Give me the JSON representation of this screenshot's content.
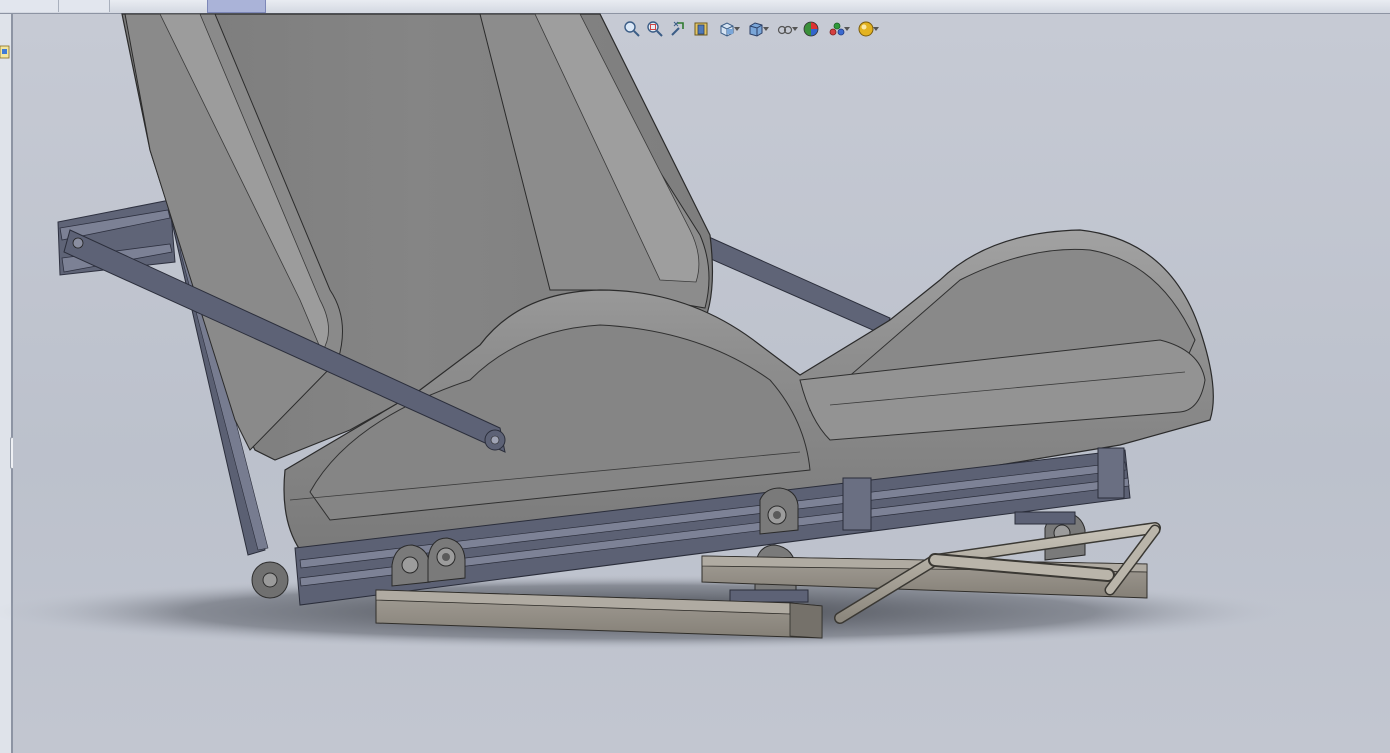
{
  "window": {
    "tabs": [
      {
        "id": "tab-1"
      },
      {
        "id": "tab-2"
      },
      {
        "id": "tab-3",
        "active": true
      }
    ]
  },
  "heads_up_toolbar": {
    "buttons": [
      {
        "name": "zoom-to-fit",
        "icon": "zoom-fit-icon"
      },
      {
        "name": "zoom-to-area",
        "icon": "zoom-area-icon"
      },
      {
        "name": "previous-view",
        "icon": "previous-view-icon"
      },
      {
        "name": "section-view",
        "icon": "section-view-icon"
      },
      {
        "name": "view-orientation",
        "icon": "view-orientation-icon",
        "dropdown": true
      },
      {
        "name": "display-style",
        "icon": "display-style-icon",
        "dropdown": true
      },
      {
        "name": "hide-show-items",
        "icon": "hide-show-icon",
        "dropdown": true
      },
      {
        "name": "edit-appearance",
        "icon": "appearance-icon"
      },
      {
        "name": "apply-scene",
        "icon": "scene-icon",
        "dropdown": true
      },
      {
        "name": "view-settings",
        "icon": "view-settings-icon",
        "dropdown": true
      }
    ]
  },
  "colors": {
    "viewport_bg": "#bfc4cf",
    "seat_shell": "#878787",
    "frame_steel": "#5d6276",
    "rail_wood": "#8f8a82"
  }
}
